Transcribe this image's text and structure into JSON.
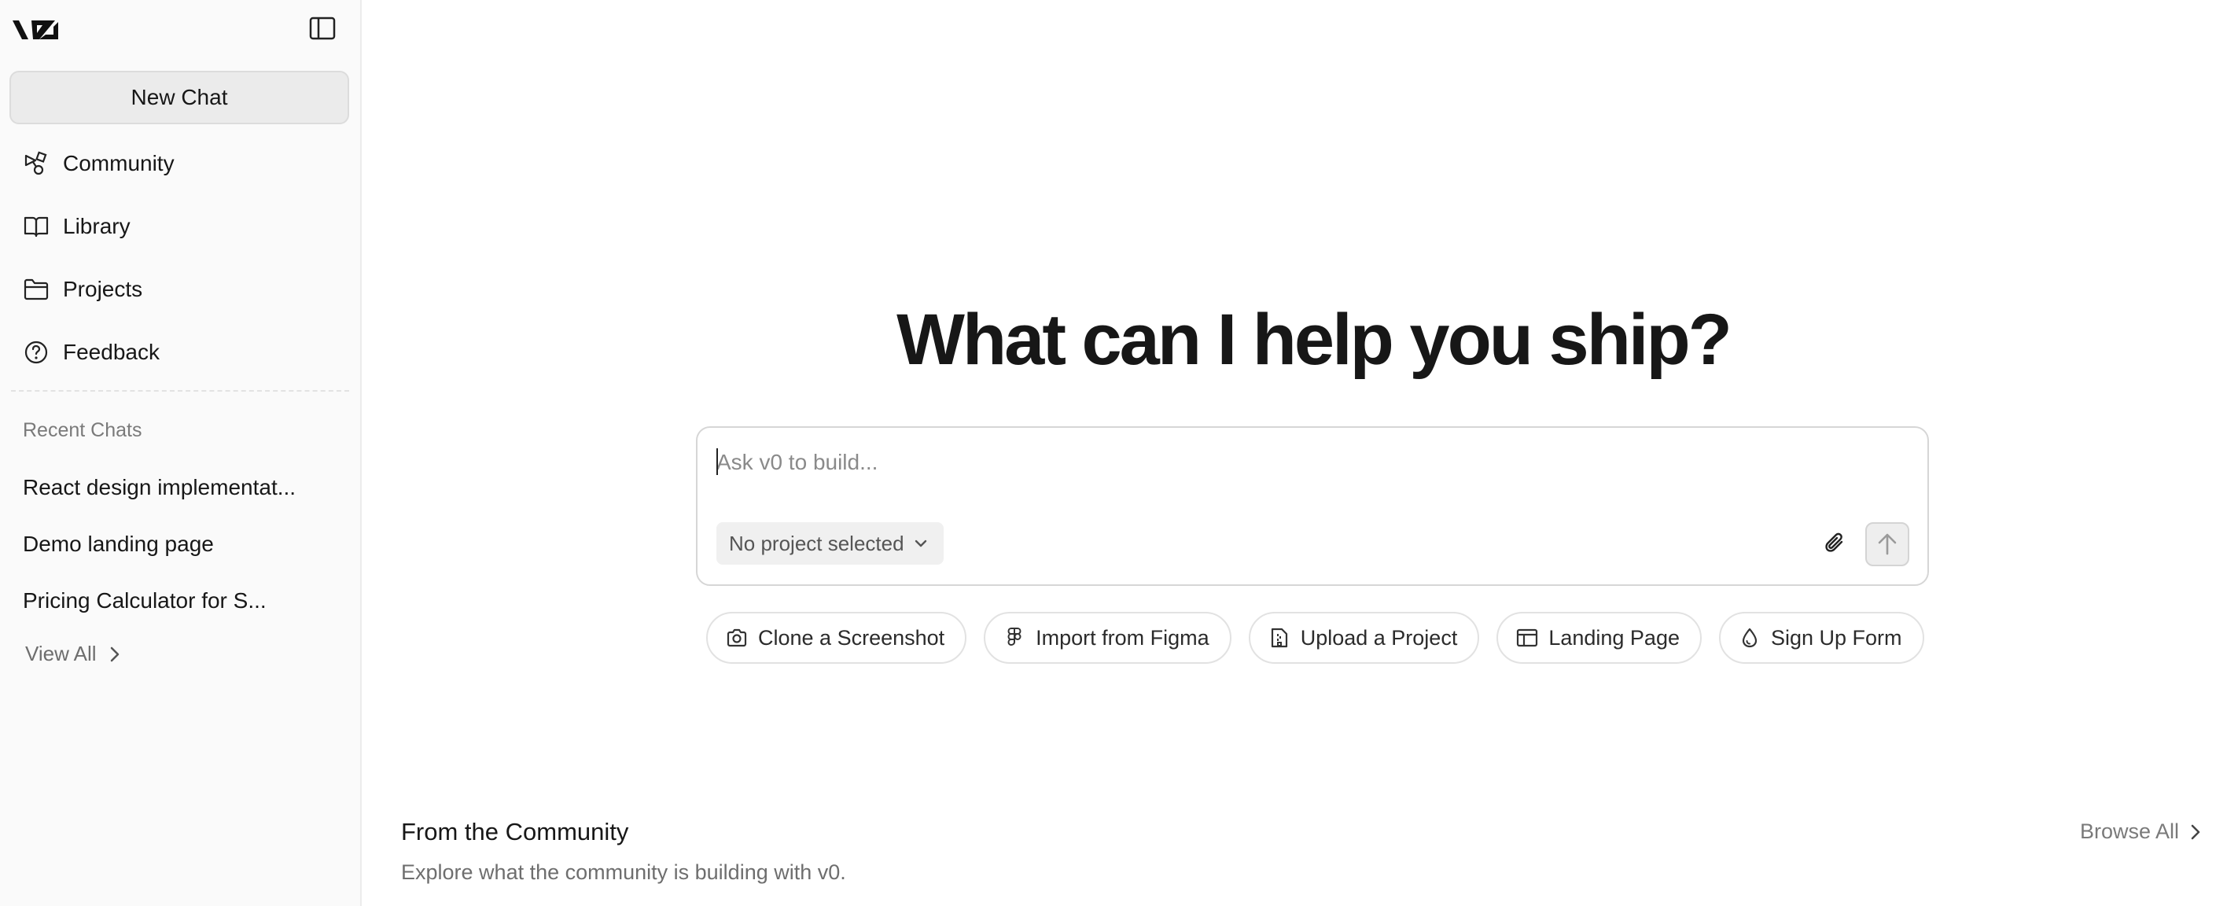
{
  "sidebar": {
    "logo": "v0",
    "new_chat_label": "New Chat",
    "nav": [
      {
        "label": "Community",
        "icon": "shapes-icon"
      },
      {
        "label": "Library",
        "icon": "book-icon"
      },
      {
        "label": "Projects",
        "icon": "folder-icon"
      },
      {
        "label": "Feedback",
        "icon": "help-circle-icon"
      }
    ],
    "recent_label": "Recent Chats",
    "recent_chats": [
      "React design implementat...",
      "Demo landing page",
      "Pricing Calculator for S..."
    ],
    "view_all_label": "View All"
  },
  "main": {
    "headline": "What can I help you ship?",
    "prompt": {
      "placeholder": "Ask v0 to build...",
      "value": "",
      "project_select": "No project selected"
    },
    "suggestions": [
      {
        "label": "Clone a Screenshot",
        "icon": "camera-icon"
      },
      {
        "label": "Import from Figma",
        "icon": "figma-icon"
      },
      {
        "label": "Upload a Project",
        "icon": "file-upload-icon"
      },
      {
        "label": "Landing Page",
        "icon": "layout-icon"
      },
      {
        "label": "Sign Up Form",
        "icon": "droplet-icon"
      }
    ],
    "community": {
      "title": "From the Community",
      "subtitle": "Explore what the community is building with v0.",
      "browse_all_label": "Browse All"
    }
  },
  "colors": {
    "sidebar_bg": "#fafafa",
    "text": "#171717",
    "muted": "#7a7a7a",
    "border": "#e2e2e2"
  }
}
